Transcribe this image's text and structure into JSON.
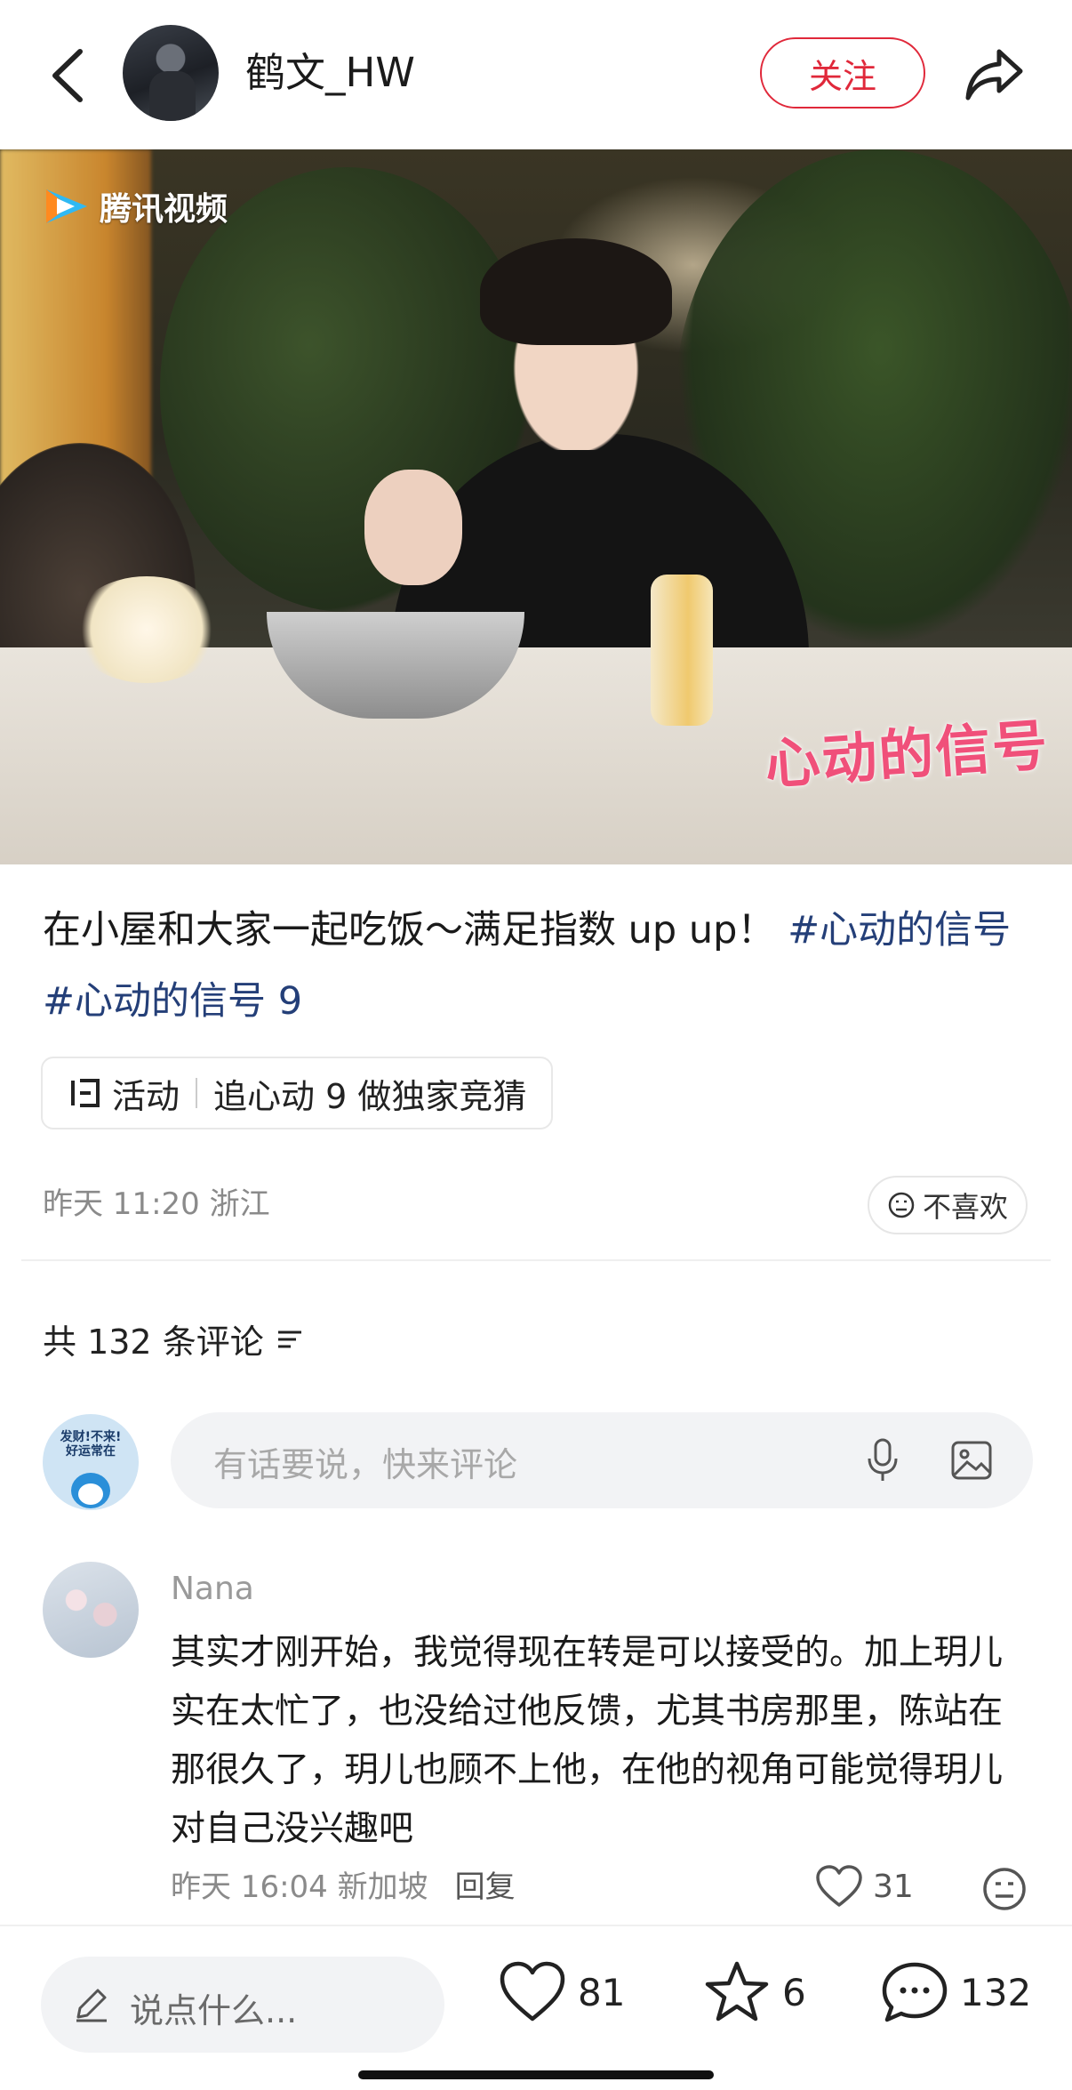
{
  "header": {
    "author_name": "鹤文_HW",
    "follow_label": "关注"
  },
  "cover": {
    "watermark": "腾讯视频",
    "show_logo": "心动的信号"
  },
  "post": {
    "caption_text": "在小屋和大家一起吃饭～满足指数 up up！",
    "hashtags": [
      "#心动的信号",
      "#心动的信号 9"
    ],
    "activity_label": "活动",
    "activity_text": "追心动 9 做独家竞猜",
    "time": "昨天 11:20",
    "location": "浙江",
    "dislike_label": "不喜欢"
  },
  "comments": {
    "header": "共 132 条评论",
    "input_placeholder": "有话要说，快来评论",
    "me_avatar_text": "发财!不来! 好运常在",
    "items": [
      {
        "user": "Nana",
        "text": "其实才刚开始，我觉得现在转是可以接受的。加上玥儿实在太忙了，也没给过他反馈，尤其书房那里，陈站在那很久了，玥儿也顾不上他，在他的视角可能觉得玥儿对自己没兴趣吧",
        "time": "昨天 16:04",
        "location": "新加坡",
        "reply_label": "回复",
        "likes": "31"
      }
    ]
  },
  "bottom_bar": {
    "input_placeholder": "说点什么...",
    "like_count": "81",
    "star_count": "6",
    "comment_count": "132"
  },
  "colors": {
    "accent_red": "#e0283a",
    "hashtag_blue": "#243f78"
  }
}
